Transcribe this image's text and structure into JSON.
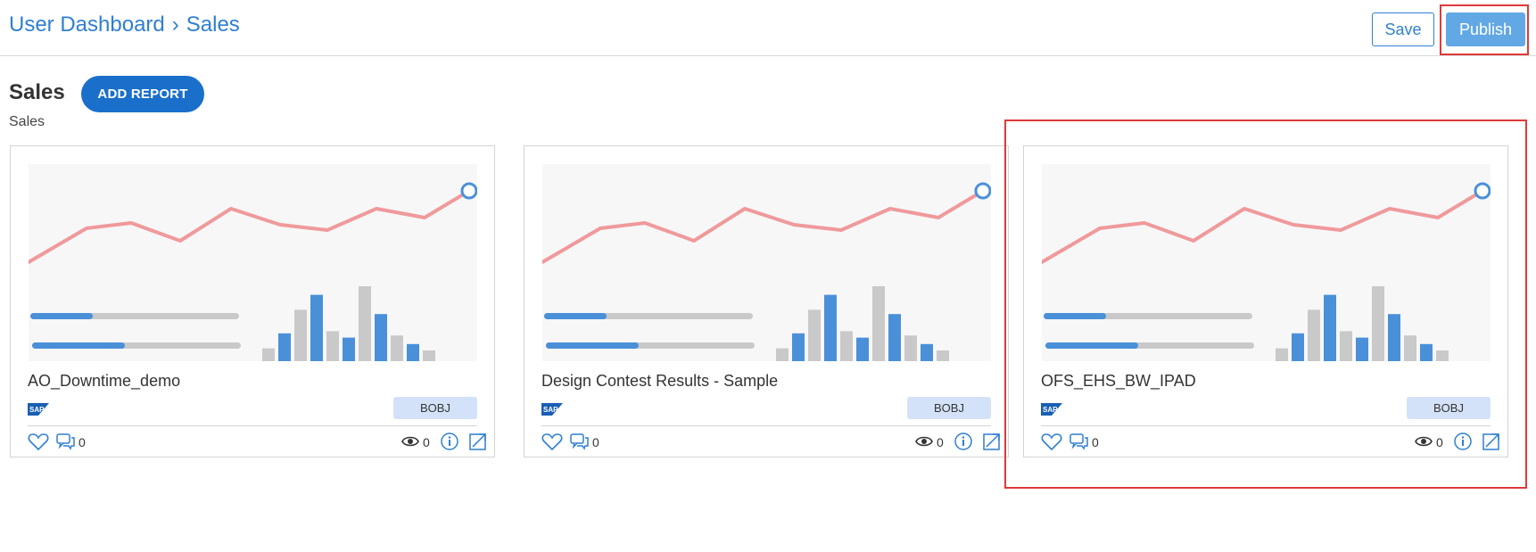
{
  "header": {
    "breadcrumb": [
      "User Dashboard",
      "Sales"
    ],
    "breadcrumb_separator": "›",
    "save_label": "Save",
    "publish_label": "Publish"
  },
  "section": {
    "title": "Sales",
    "subtitle": "Sales",
    "add_report_label": "ADD REPORT"
  },
  "cards": [
    {
      "title": "AO_Downtime_demo",
      "logo": "SAP",
      "tag": "BOBJ",
      "comments": "0",
      "views": "0"
    },
    {
      "title": "Design Contest Results - Sample",
      "logo": "SAP",
      "tag": "BOBJ",
      "comments": "0",
      "views": "0"
    },
    {
      "title": "OFS_EHS_BW_IPAD",
      "logo": "SAP",
      "tag": "BOBJ",
      "comments": "0",
      "views": "0"
    }
  ],
  "icons": {
    "like": "heart-icon",
    "comments": "comment-icon",
    "views": "eye-icon",
    "info": "info-icon",
    "open": "external-link-icon"
  },
  "colors": {
    "accent": "#2f7fd0",
    "primary_button": "#1a6fcb",
    "publish_button": "#62a8e5",
    "highlight": "#e0393a",
    "tag_bg": "#d4e2f9",
    "thumb_line": "#f0999b",
    "thumb_bar_blue": "#4a90d9",
    "thumb_bar_gray": "#c9c9c9"
  }
}
